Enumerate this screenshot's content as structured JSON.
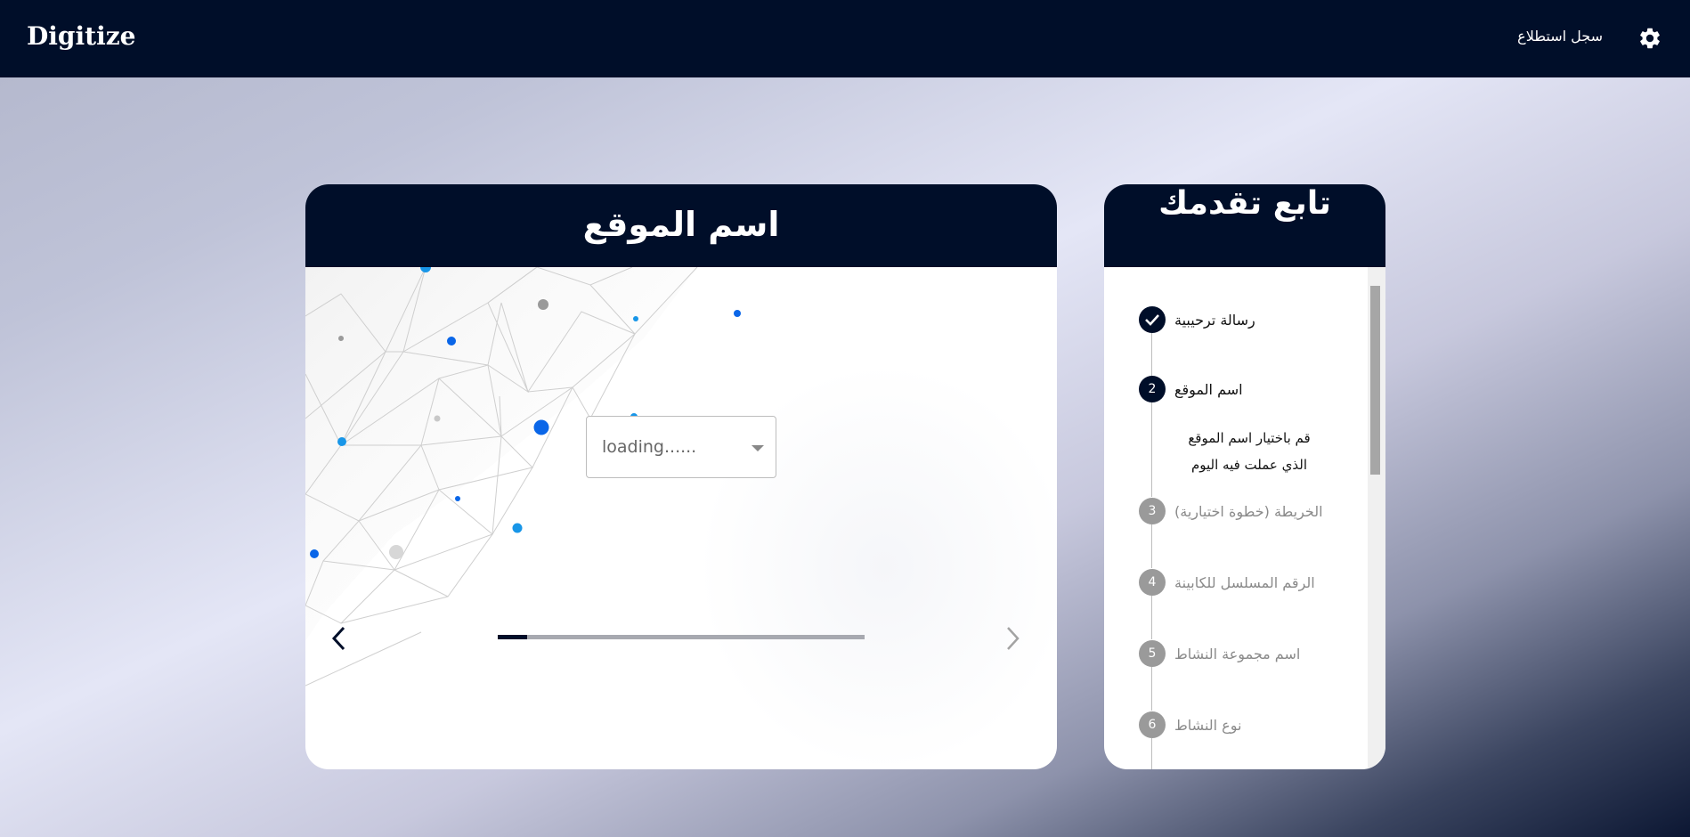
{
  "app": {
    "brand": "Digitize",
    "survey_log_label": "سجل استطلاع",
    "settings_icon": "gear-icon"
  },
  "main": {
    "title": "اسم الموقع",
    "select": {
      "value": "loading......"
    },
    "progress": {
      "fraction": 0.08
    }
  },
  "side": {
    "title": "تابع تقدمك",
    "steps": [
      {
        "marker": "",
        "label": "رسالة ترحيبية",
        "status": "done"
      },
      {
        "marker": "2",
        "label": "اسم الموقع",
        "status": "active",
        "description": "قم باختيار اسم الموقع الذي عملت فيه اليوم"
      },
      {
        "marker": "3",
        "label": "الخريطة (خطوة اختيارية)",
        "status": "pending"
      },
      {
        "marker": "4",
        "label": "الرقم المسلسل للكابينة",
        "status": "pending"
      },
      {
        "marker": "5",
        "label": "اسم مجموعة النشاط",
        "status": "pending"
      },
      {
        "marker": "6",
        "label": "نوع النشاط",
        "status": "pending"
      }
    ]
  },
  "colors": {
    "navy": "#000e29",
    "pending": "#9a9a9a",
    "dot_blue": "#0a66e8",
    "dot_cyan": "#1896e8",
    "dot_gray": "#9a9a9a"
  }
}
